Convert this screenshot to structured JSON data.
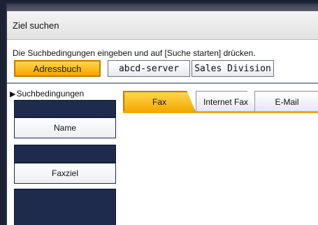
{
  "header": {
    "title": "Ziel suchen"
  },
  "instruction": "Die Suchbedingungen eingeben und auf [Suche starten] drücken.",
  "address_sources": [
    {
      "label": "Adressbuch",
      "selected": true
    },
    {
      "label": "abcd-server",
      "selected": false
    },
    {
      "label": "Sales Division",
      "selected": false
    }
  ],
  "conditions": {
    "label": "Suchbedingungen",
    "fields": [
      {
        "label": "Name"
      },
      {
        "label": "Faxziel"
      }
    ]
  },
  "tabs": [
    {
      "label": "Fax",
      "active": true
    },
    {
      "label": "Internet Fax",
      "active": false
    },
    {
      "label": "E-Mail",
      "active": false
    }
  ],
  "colors": {
    "accent": "#f3a800",
    "navy": "#1e2b4c"
  }
}
